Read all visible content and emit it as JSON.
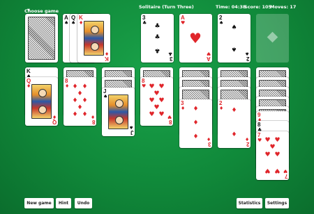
{
  "header": {
    "choose_game": "Choose game",
    "caret": "▼",
    "title": "Solitaire (Turn Three)",
    "time": "Time: 04:38",
    "score": "Score: 105",
    "moves": "Moves: 17"
  },
  "stock": {
    "label": "stock-pile"
  },
  "waste": [
    {
      "rank": "A",
      "suit": "♠",
      "color": "black"
    },
    {
      "rank": "Q",
      "suit": "♠",
      "color": "black"
    },
    {
      "rank": "K",
      "suit": "♦",
      "color": "red"
    }
  ],
  "foundations": [
    {
      "rank": "3",
      "suit": "♣",
      "color": "black"
    },
    {
      "rank": "A",
      "suit": "♥",
      "color": "red"
    },
    {
      "rank": "2",
      "suit": "♠",
      "color": "black"
    },
    {
      "rank": "",
      "suit": "♦",
      "color": "empty"
    }
  ],
  "tableau": [
    {
      "face_down": 0,
      "cards": [
        {
          "rank": "K",
          "suit": "♠"
        },
        {
          "rank": "Q",
          "suit": "♦"
        }
      ]
    },
    {
      "face_down": 1,
      "cards": [
        {
          "rank": "8",
          "suit": "♦"
        }
      ]
    },
    {
      "face_down": 2,
      "cards": [
        {
          "rank": "J",
          "suit": "♠"
        }
      ]
    },
    {
      "face_down": 1,
      "cards": [
        {
          "rank": "8",
          "suit": "♥"
        }
      ]
    },
    {
      "face_down": 3,
      "cards": [
        {
          "rank": "3",
          "suit": "♦"
        }
      ]
    },
    {
      "face_down": 3,
      "cards": [
        {
          "rank": "2",
          "suit": "♦"
        }
      ]
    },
    {
      "face_down": 5,
      "cards": [
        {
          "rank": "9",
          "suit": "♦"
        },
        {
          "rank": "8",
          "suit": "♣"
        },
        {
          "rank": "7",
          "suit": "♥"
        }
      ]
    }
  ],
  "buttons": {
    "new_game": "New game",
    "hint": "Hint",
    "undo": "Undo",
    "statistics": "Statistics",
    "settings": "Settings"
  }
}
